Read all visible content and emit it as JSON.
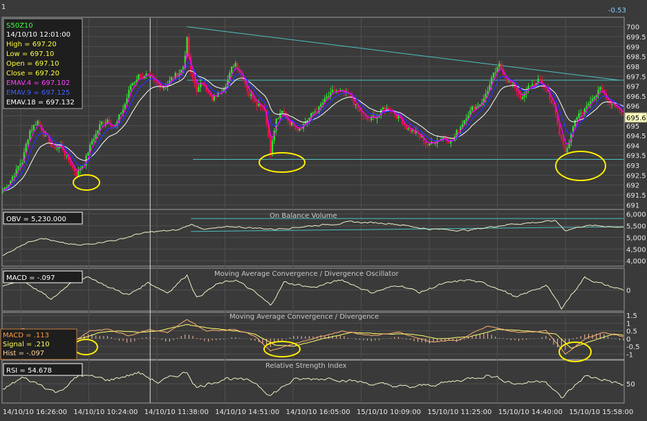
{
  "window": {
    "corner_label": "1",
    "change_value": "-0.53"
  },
  "colors": {
    "background": "#3a3a3a",
    "grid": "#4f4f4f",
    "bull": "#33dd33",
    "bear": "#ee1144",
    "ema_fast": "#ff00ff",
    "ema_mid": "#3030ff",
    "ema_slow": "#ffffff",
    "indicator_line": "#f0f0c8",
    "trendline": "#4fc0c0",
    "highlight": "#ffee00",
    "last_price_box": "#ffffc0"
  },
  "price_panel": {
    "info": {
      "symbol": "S50Z10",
      "datetime": "14/10/10 12:01:00",
      "high": "High  = 697.20",
      "low": "Low   = 697.10",
      "open": "Open = 697.10",
      "close": "Close = 697.20",
      "ema4": "EMAV.4 = 697.102",
      "ema9": "EMAV.9 = 697.125",
      "ema18": "EMAV.18 = 697.132"
    },
    "last_price_label": "695.6"
  },
  "obv_panel": {
    "title": "On Balance Volume",
    "value_label": "OBV = 5,230.000"
  },
  "macd_osc_panel": {
    "title": "Moving Average Convergence / Divergence Oscillator",
    "value_label": "MACD = -.097"
  },
  "macd_panel": {
    "title": "Moving Average Convergence / Divergence",
    "macd_label": "MACD = .113",
    "signal_label": "Signal = .210",
    "hist_label": "Hist = -.097"
  },
  "rsi_panel": {
    "title": "Relative Strength Index",
    "value_label": "RSI = 54.678"
  },
  "chart_data": [
    {
      "type": "candlestick",
      "name": "price",
      "ylim": [
        690.8,
        700.2
      ],
      "y_ticks": [
        "700",
        "699.5",
        "699",
        "698.5",
        "698",
        "697.5",
        "697",
        "696.5",
        "696",
        "695.5",
        "695",
        "694.5",
        "694",
        "693.5",
        "693",
        "692.5",
        "692",
        "691.5",
        "691"
      ],
      "x_tick_labels": [
        "14/10/10 16:26:00",
        "14/10/10 10:24:00",
        "14/10/10 11:38:00",
        "14/10/10 14:51:00",
        "14/10/10 16:05:00",
        "15/10/10 10:09:00",
        "15/10/10 11:25:00",
        "15/10/10 14:40:00",
        "15/10/10 15:58:00"
      ],
      "session_divider_index": 76,
      "close_profile": [
        [
          0,
          691.7
        ],
        [
          5,
          692.5
        ],
        [
          10,
          693.2
        ],
        [
          14,
          694.8
        ],
        [
          18,
          695.3
        ],
        [
          22,
          694.5
        ],
        [
          26,
          693.8
        ],
        [
          30,
          694.0
        ],
        [
          34,
          693.2
        ],
        [
          38,
          692.6
        ],
        [
          42,
          693.2
        ],
        [
          46,
          694.2
        ],
        [
          50,
          695.0
        ],
        [
          54,
          695.4
        ],
        [
          58,
          695.0
        ],
        [
          62,
          695.8
        ],
        [
          66,
          697.0
        ],
        [
          70,
          697.6
        ],
        [
          74,
          697.5
        ],
        [
          78,
          697.0
        ],
        [
          82,
          697.0
        ],
        [
          86,
          697.3
        ],
        [
          90,
          697.6
        ],
        [
          93,
          698.0
        ],
        [
          95,
          699.4
        ],
        [
          97,
          697.5
        ],
        [
          100,
          696.8
        ],
        [
          104,
          697.2
        ],
        [
          108,
          696.2
        ],
        [
          112,
          696.7
        ],
        [
          116,
          697.5
        ],
        [
          120,
          698.2
        ],
        [
          124,
          697.5
        ],
        [
          127,
          696.7
        ],
        [
          131,
          696.3
        ],
        [
          135,
          696.0
        ],
        [
          138,
          693.8
        ],
        [
          141,
          695.3
        ],
        [
          144,
          695.6
        ],
        [
          148,
          695.2
        ],
        [
          152,
          695.0
        ],
        [
          156,
          695.3
        ],
        [
          160,
          695.6
        ],
        [
          164,
          696.0
        ],
        [
          168,
          696.4
        ],
        [
          172,
          696.7
        ],
        [
          176,
          696.5
        ],
        [
          180,
          696.3
        ],
        [
          184,
          695.6
        ],
        [
          188,
          695.2
        ],
        [
          192,
          695.4
        ],
        [
          196,
          695.8
        ],
        [
          200,
          695.9
        ],
        [
          204,
          695.5
        ],
        [
          208,
          695.0
        ],
        [
          212,
          694.7
        ],
        [
          216,
          694.3
        ],
        [
          220,
          694.0
        ],
        [
          224,
          694.4
        ],
        [
          228,
          694.5
        ],
        [
          232,
          694.3
        ],
        [
          236,
          695.0
        ],
        [
          240,
          695.8
        ],
        [
          244,
          696.0
        ],
        [
          248,
          696.4
        ],
        [
          252,
          697.3
        ],
        [
          256,
          697.9
        ],
        [
          260,
          697.4
        ],
        [
          264,
          696.9
        ],
        [
          268,
          696.4
        ],
        [
          272,
          697.0
        ],
        [
          276,
          697.2
        ],
        [
          280,
          696.9
        ],
        [
          284,
          696.0
        ],
        [
          287,
          694.5
        ],
        [
          290,
          693.8
        ],
        [
          293,
          694.6
        ],
        [
          296,
          695.3
        ],
        [
          300,
          695.8
        ],
        [
          304,
          696.6
        ],
        [
          308,
          696.8
        ],
        [
          312,
          696.3
        ],
        [
          316,
          696.1
        ],
        [
          320,
          695.6
        ]
      ],
      "trendlines": [
        {
          "from": [
            95,
            700.0
          ],
          "to": [
            318,
            697.3
          ]
        },
        {
          "from": [
            95,
            697.3
          ],
          "to": [
            320,
            697.3
          ]
        },
        {
          "from": [
            98,
            693.3
          ],
          "to": [
            320,
            693.3
          ]
        }
      ]
    },
    {
      "type": "line",
      "name": "obv",
      "ylim": [
        3800,
        6100
      ],
      "y_ticks": [
        "6,000",
        "5,500",
        "5,000",
        "4,500",
        "4,000"
      ],
      "profile": [
        [
          0,
          4200
        ],
        [
          10,
          4700
        ],
        [
          20,
          5000
        ],
        [
          30,
          4750
        ],
        [
          40,
          4650
        ],
        [
          50,
          4800
        ],
        [
          60,
          4900
        ],
        [
          70,
          5150
        ],
        [
          80,
          5250
        ],
        [
          90,
          5300
        ],
        [
          97,
          5550
        ],
        [
          105,
          5350
        ],
        [
          120,
          5450
        ],
        [
          140,
          5350
        ],
        [
          160,
          5500
        ],
        [
          180,
          5650
        ],
        [
          200,
          5600
        ],
        [
          220,
          5350
        ],
        [
          240,
          5300
        ],
        [
          260,
          5550
        ],
        [
          285,
          5700
        ],
        [
          290,
          5300
        ],
        [
          300,
          5500
        ],
        [
          320,
          5450
        ]
      ],
      "trendlines": [
        {
          "from": [
            97,
            5800
          ],
          "to": [
            320,
            5800
          ]
        },
        {
          "from": [
            97,
            5250
          ],
          "to": [
            320,
            5450
          ]
        }
      ]
    },
    {
      "type": "line",
      "name": "macd_oscillator",
      "ylim": [
        -0.4,
        0.4
      ],
      "y_ticks": [
        "0"
      ],
      "profile": [
        [
          0,
          0.05
        ],
        [
          10,
          0.2
        ],
        [
          20,
          -0.05
        ],
        [
          25,
          -0.2
        ],
        [
          35,
          0.15
        ],
        [
          45,
          0.25
        ],
        [
          55,
          0.05
        ],
        [
          65,
          -0.1
        ],
        [
          75,
          0.15
        ],
        [
          85,
          -0.05
        ],
        [
          95,
          0.3
        ],
        [
          100,
          -0.15
        ],
        [
          110,
          0.1
        ],
        [
          120,
          0.2
        ],
        [
          130,
          -0.05
        ],
        [
          138,
          -0.3
        ],
        [
          145,
          0.15
        ],
        [
          160,
          0.05
        ],
        [
          175,
          0.2
        ],
        [
          190,
          -0.05
        ],
        [
          205,
          0.1
        ],
        [
          215,
          -0.05
        ],
        [
          225,
          0.1
        ],
        [
          240,
          0.2
        ],
        [
          255,
          0.05
        ],
        [
          265,
          -0.15
        ],
        [
          280,
          0.1
        ],
        [
          288,
          -0.35
        ],
        [
          300,
          0.25
        ],
        [
          310,
          0.1
        ],
        [
          320,
          0.0
        ]
      ]
    },
    {
      "type": "line",
      "name": "macd",
      "ylim": [
        -1.3,
        1.6
      ],
      "y_ticks": [
        "1.5",
        "1",
        "0.5",
        "0",
        "-0.5",
        "-1"
      ],
      "macd_profile": [
        [
          0,
          0.2
        ],
        [
          10,
          0.6
        ],
        [
          20,
          0.4
        ],
        [
          28,
          -0.6
        ],
        [
          35,
          -0.3
        ],
        [
          45,
          0.5
        ],
        [
          55,
          0.6
        ],
        [
          65,
          0.2
        ],
        [
          75,
          0.6
        ],
        [
          85,
          0.4
        ],
        [
          95,
          1.2
        ],
        [
          105,
          0.5
        ],
        [
          120,
          0.6
        ],
        [
          130,
          0.2
        ],
        [
          138,
          -0.8
        ],
        [
          145,
          -0.5
        ],
        [
          160,
          0.0
        ],
        [
          175,
          0.5
        ],
        [
          190,
          0.2
        ],
        [
          205,
          0.4
        ],
        [
          220,
          -0.2
        ],
        [
          235,
          -0.1
        ],
        [
          250,
          0.8
        ],
        [
          265,
          0.4
        ],
        [
          280,
          0.5
        ],
        [
          290,
          -1.0
        ],
        [
          300,
          0.0
        ],
        [
          310,
          0.4
        ],
        [
          320,
          0.1
        ]
      ],
      "signal_profile": [
        [
          0,
          0.3
        ],
        [
          10,
          0.5
        ],
        [
          20,
          0.5
        ],
        [
          30,
          -0.2
        ],
        [
          40,
          0.0
        ],
        [
          50,
          0.4
        ],
        [
          60,
          0.5
        ],
        [
          70,
          0.4
        ],
        [
          80,
          0.5
        ],
        [
          95,
          0.9
        ],
        [
          105,
          0.7
        ],
        [
          120,
          0.5
        ],
        [
          130,
          0.3
        ],
        [
          140,
          -0.4
        ],
        [
          150,
          -0.5
        ],
        [
          165,
          0.0
        ],
        [
          180,
          0.4
        ],
        [
          195,
          0.3
        ],
        [
          210,
          0.3
        ],
        [
          225,
          0.0
        ],
        [
          240,
          0.1
        ],
        [
          255,
          0.6
        ],
        [
          270,
          0.5
        ],
        [
          285,
          0.3
        ],
        [
          293,
          -0.6
        ],
        [
          305,
          -0.1
        ],
        [
          315,
          0.3
        ],
        [
          320,
          0.2
        ]
      ]
    },
    {
      "type": "line",
      "name": "rsi",
      "ylim": [
        25,
        80
      ],
      "y_ticks": [
        "50"
      ],
      "profile": [
        [
          0,
          42
        ],
        [
          10,
          58
        ],
        [
          20,
          48
        ],
        [
          28,
          38
        ],
        [
          40,
          62
        ],
        [
          55,
          55
        ],
        [
          70,
          65
        ],
        [
          80,
          52
        ],
        [
          95,
          66
        ],
        [
          100,
          45
        ],
        [
          115,
          58
        ],
        [
          130,
          52
        ],
        [
          138,
          35
        ],
        [
          150,
          55
        ],
        [
          170,
          58
        ],
        [
          190,
          50
        ],
        [
          210,
          45
        ],
        [
          230,
          52
        ],
        [
          250,
          62
        ],
        [
          265,
          50
        ],
        [
          280,
          55
        ],
        [
          288,
          30
        ],
        [
          300,
          60
        ],
        [
          310,
          56
        ],
        [
          320,
          48
        ]
      ]
    }
  ]
}
